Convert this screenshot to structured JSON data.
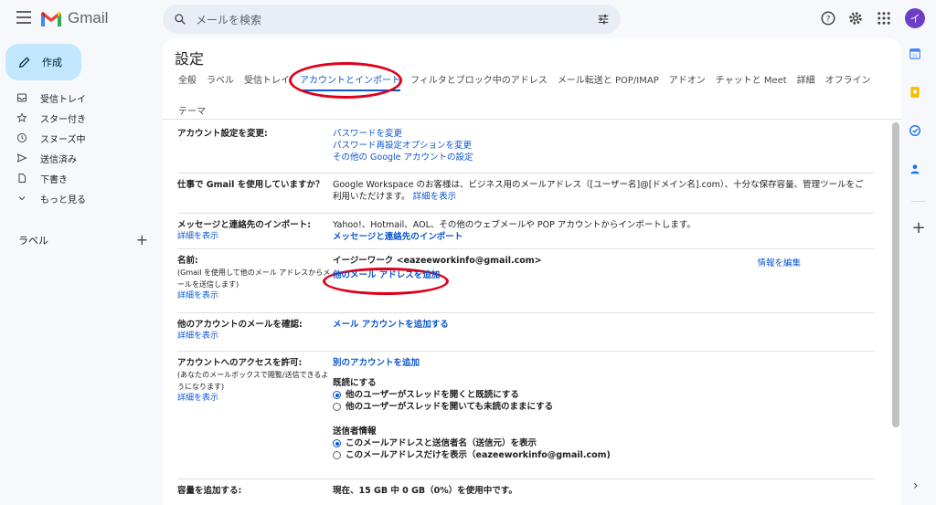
{
  "header": {
    "app_name": "Gmail",
    "search_placeholder": "メールを検索",
    "avatar_letter": "イ"
  },
  "sidebar": {
    "compose_label": "作成",
    "items": [
      {
        "label": "受信トレイ",
        "icon": "inbox-icon"
      },
      {
        "label": "スター付き",
        "icon": "star-icon"
      },
      {
        "label": "スヌーズ中",
        "icon": "clock-icon"
      },
      {
        "label": "送信済み",
        "icon": "send-icon"
      },
      {
        "label": "下書き",
        "icon": "draft-icon"
      },
      {
        "label": "もっと見る",
        "icon": "chevron-down-icon"
      }
    ],
    "labels_heading": "ラベル",
    "labels_add": "+"
  },
  "settings": {
    "title": "設定",
    "tabs": [
      "全般",
      "ラベル",
      "受信トレイ",
      "アカウントとインポート",
      "フィルタとブロック中のアドレス",
      "メール転送と POP/IMAP",
      "アドオン",
      "チャットと Meet",
      "詳細",
      "オフライン",
      "テーマ"
    ],
    "active_tab_index": 3,
    "rows": {
      "change_account": {
        "label": "アカウント設定を変更:",
        "links": [
          "パスワードを変更",
          "パスワード再設定オプションを変更",
          "その他の Google アカウントの設定"
        ]
      },
      "workspace": {
        "label": "仕事で Gmail を使用していますか？",
        "text": "Google Workspace のお客様は、ビジネス用のメールアドレス（[ユーザー名]@[ドメイン名].com）、十分な保存容量、管理ツールをご利用いただけます。",
        "link": "詳細を表示"
      },
      "import": {
        "label": "メッセージと連絡先のインポート:",
        "sublink": "詳細を表示",
        "text": "Yahoo!、Hotmail、AOL、その他のウェブメールや POP アカウントからインポートします。",
        "link": "メッセージと連絡先のインポート"
      },
      "name": {
        "label": "名前:",
        "sub": "(Gmail を使用して他のメール アドレスからメールを送信します)",
        "sublink": "詳細を表示",
        "value": "イージーワーク <eazeeworkinfo@gmail.com>",
        "edit": "情報を編集",
        "add_link": "他のメール アドレスを追加"
      },
      "check_mail": {
        "label": "他のアカウントのメールを確認:",
        "sublink": "詳細を表示",
        "link": "メール アカウントを追加する"
      },
      "grant_access": {
        "label": "アカウントへのアクセスを許可:",
        "sub": "(あなたのメールボックスで閲覧/送信できるようになります)",
        "sublink": "詳細を表示",
        "link": "別のアカウントを追加",
        "mark_read_heading": "既読にする",
        "mark_read_opt1": "他のユーザーがスレッドを開くと既読にする",
        "mark_read_opt2": "他のユーザーがスレッドを開いても未読のままにする",
        "sender_heading": "送信者情報",
        "sender_opt1": "このメールアドレスと送信者名（送信元）を表示",
        "sender_opt2": "このメールアドレスだけを表示（eazeeworkinfo@gmail.com)"
      },
      "storage": {
        "label": "容量を追加する:",
        "text": "現在、15 GB 中 0 GB（0%）を使用中です。"
      }
    }
  },
  "colors": {
    "accent": "#0b57d0",
    "highlight_oval": "#e0001b",
    "compose_bg": "#c2e7ff"
  }
}
